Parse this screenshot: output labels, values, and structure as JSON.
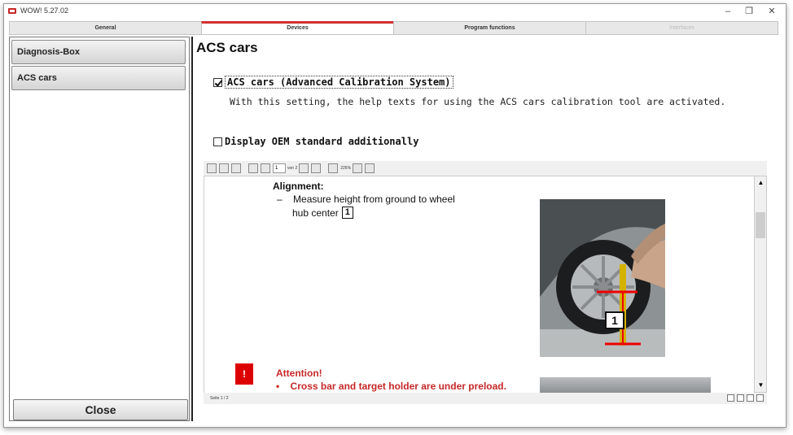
{
  "window": {
    "title": "WOW! 5.27.02",
    "minimize": "–",
    "restore": "❐",
    "close": "✕"
  },
  "tabs": [
    {
      "label": "General",
      "state": "normal"
    },
    {
      "label": "Devices",
      "state": "active"
    },
    {
      "label": "Program functions",
      "state": "normal"
    },
    {
      "label": "Interfaces",
      "state": "disabled"
    }
  ],
  "sidebar": {
    "items": [
      {
        "label": "Diagnosis-Box"
      },
      {
        "label": "ACS cars"
      }
    ],
    "close_label": "Close"
  },
  "main": {
    "title": "ACS cars",
    "acs_option": {
      "label": "ACS cars (Advanced Calibration System)",
      "checked": true
    },
    "acs_help": "With this setting, the help texts for using the ACS cars calibration tool are activated.",
    "oem_option": {
      "label": "Display OEM standard additionally",
      "checked": false
    }
  },
  "pdf": {
    "page_input": "1",
    "page_of": "von 2",
    "zoom": "226%",
    "status": "Seite 1 / 2",
    "content": {
      "heading": "Alignment:",
      "dash": "–",
      "bullet_line1": "Measure height from ground to wheel",
      "bullet_line2": "hub center",
      "bullet_number": "1",
      "photo_number": "1",
      "attention_mark": "!",
      "attention_title": "Attention!",
      "attention_bullet": "•",
      "attention_text": "Cross bar and target holder are under preload."
    }
  },
  "colors": {
    "active_tab_accent": "#d32f2f",
    "attention_red": "#c62828"
  }
}
